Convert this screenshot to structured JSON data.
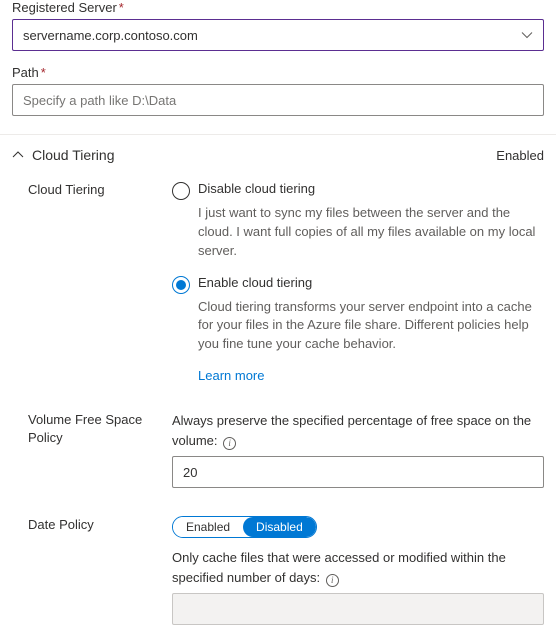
{
  "registeredServer": {
    "label": "Registered Server",
    "value": "servername.corp.contoso.com"
  },
  "path": {
    "label": "Path",
    "placeholder": "Specify a path like D:\\Data",
    "value": ""
  },
  "section": {
    "title": "Cloud Tiering",
    "status": "Enabled"
  },
  "cloudTiering": {
    "label": "Cloud Tiering",
    "disableOption": {
      "title": "Disable cloud tiering",
      "desc": "I just want to sync my files between the server and the cloud. I want full copies of all my files available on my local server."
    },
    "enableOption": {
      "title": "Enable cloud tiering",
      "desc": "Cloud tiering transforms your server endpoint into a cache for your files in the Azure file share. Different policies help you fine tune your cache behavior."
    },
    "learnMore": "Learn more"
  },
  "volumePolicy": {
    "label": "Volume Free Space Policy",
    "help": "Always preserve the specified percentage of free space on the volume:",
    "value": "20"
  },
  "datePolicy": {
    "label": "Date Policy",
    "enabledLabel": "Enabled",
    "disabledLabel": "Disabled",
    "help": "Only cache files that were accessed or modified within the specified number of days:",
    "value": ""
  }
}
